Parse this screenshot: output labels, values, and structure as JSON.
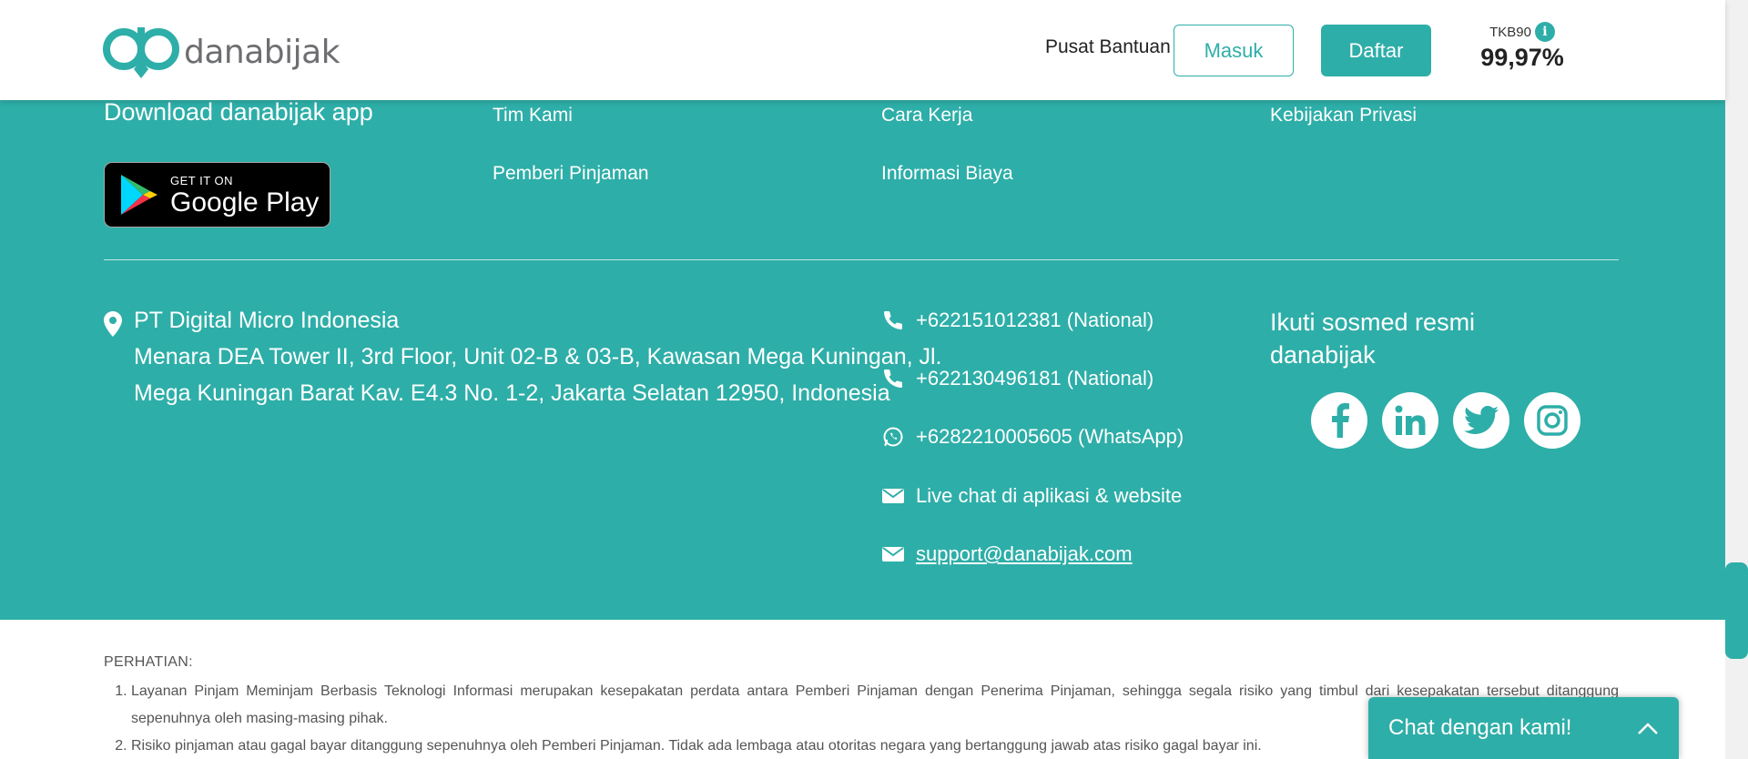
{
  "header": {
    "logo_text": "danabijak",
    "help_link": "Pusat Bantuan",
    "login_label": "Masuk",
    "register_label": "Daftar",
    "tkb_label": "TKB90",
    "tkb_info_icon": "info-icon",
    "tkb_value": "99,97%"
  },
  "footer": {
    "download_title": "Download danabijak app",
    "google_play": {
      "small": "GET IT ON",
      "big": "Google Play"
    },
    "links": [
      "Tim Kami",
      "Pemberi Pinjaman",
      "Cara Kerja",
      "Informasi Biaya",
      "Kebijakan Privasi"
    ],
    "address": {
      "company": "PT Digital Micro Indonesia",
      "line1": "Menara DEA Tower II, 3rd Floor, Unit 02-B & 03-B, Kawasan Mega Kuningan, Jl.",
      "line2": "Mega Kuningan Barat Kav. E4.3 No. 1-2, Jakarta Selatan 12950, Indonesia"
    },
    "contacts": [
      {
        "icon": "phone-icon",
        "text": "+622151012381 (National)"
      },
      {
        "icon": "phone-icon",
        "text": "+622130496181 (National)"
      },
      {
        "icon": "whatsapp-icon",
        "text": "+6282210005605 (WhatsApp)"
      },
      {
        "icon": "mail-icon",
        "text": "Live chat di aplikasi & website"
      },
      {
        "icon": "mail-icon",
        "text": "support@danabijak.com"
      }
    ],
    "social_title": "Ikuti sosmed resmi danabijak",
    "social_icons": [
      "facebook-icon",
      "linkedin-icon",
      "twitter-icon",
      "instagram-icon"
    ]
  },
  "disclaimer": {
    "title": "PERHATIAN:",
    "items": [
      "Layanan Pinjam Meminjam Berbasis Teknologi Informasi merupakan kesepakatan perdata antara Pemberi Pinjaman dengan Penerima Pinjaman, sehingga segala risiko yang timbul dari kesepakatan tersebut ditanggung sepenuhnya oleh masing-masing pihak.",
      "Risiko pinjaman atau gagal bayar ditanggung sepenuhnya oleh Pemberi Pinjaman. Tidak ada lembaga atau otoritas negara yang bertanggung jawab atas risiko gagal bayar ini."
    ]
  },
  "chat": {
    "label": "Chat dengan kami!"
  },
  "colors": {
    "brand": "#2eaea8",
    "text_dark": "#222222",
    "logo_gray": "#6d6e71"
  }
}
